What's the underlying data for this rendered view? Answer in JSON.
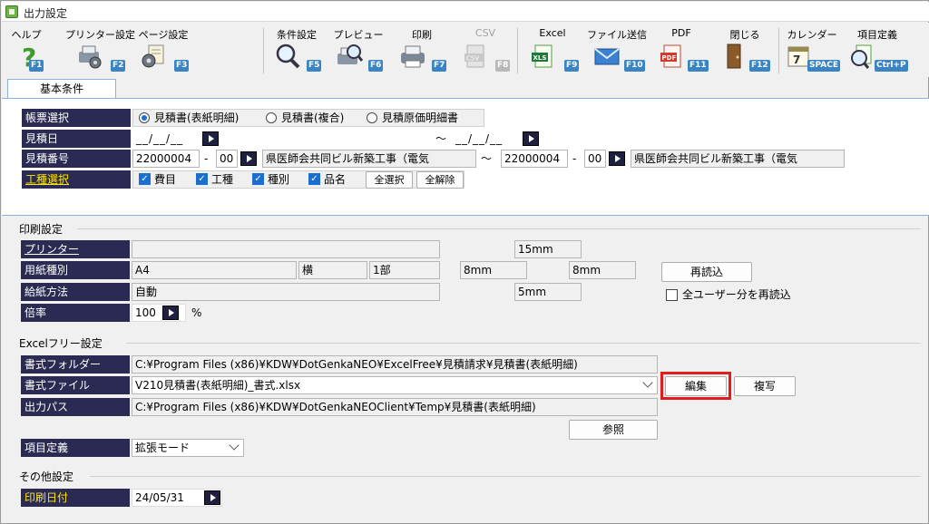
{
  "window": {
    "title": "出力設定"
  },
  "toolbar": [
    {
      "label": "ヘルプ",
      "key": "F1",
      "icon": "help-icon"
    },
    {
      "label": "プリンター設定",
      "key": "F2",
      "icon": "printer-settings-icon"
    },
    {
      "label": "ページ設定",
      "key": "F3",
      "icon": "page-settings-icon"
    },
    {
      "label": "条件設定",
      "key": "F5",
      "icon": "search-condition-icon"
    },
    {
      "label": "プレビュー",
      "key": "F6",
      "icon": "preview-icon"
    },
    {
      "label": "印刷",
      "key": "F7",
      "icon": "print-icon"
    },
    {
      "label": "CSV",
      "key": "F8",
      "icon": "csv-icon",
      "disabled": true
    },
    {
      "label": "Excel",
      "key": "F9",
      "icon": "excel-icon"
    },
    {
      "label": "ファイル送信",
      "key": "F10",
      "icon": "mail-icon"
    },
    {
      "label": "PDF",
      "key": "F11",
      "icon": "pdf-icon"
    },
    {
      "label": "閉じる",
      "key": "F12",
      "icon": "door-exit-icon"
    },
    {
      "label": "カレンダー",
      "key": "SPACE",
      "icon": "calendar-icon"
    },
    {
      "label": "項目定義",
      "key": "Ctrl+P",
      "icon": "field-definition-icon"
    }
  ],
  "tabs": [
    {
      "label": "基本条件"
    }
  ],
  "basic": {
    "report_label": "帳票選択",
    "report_options": [
      "見積書(表紙明細)",
      "見積書(複合)",
      "見積原価明細書"
    ],
    "date_label": "見積日",
    "date_from": "__/__/__",
    "date_tilde": "～",
    "date_to": "__/__/__",
    "number_label": "見積番号",
    "num_from": "22000004",
    "num_dash": "-",
    "num_from_branch": "00",
    "num_from_name": "県医師会共同ビル新築工事（電気",
    "num_tilde": "～",
    "num_to": "22000004",
    "num_to_branch": "00",
    "num_to_name": "県医師会共同ビル新築工事（電気",
    "kind_label": "工種選択",
    "kinds": [
      "費目",
      "工種",
      "種別",
      "品名"
    ],
    "select_all": "全選択",
    "clear_all": "全解除"
  },
  "print": {
    "section": "印刷設定",
    "printer_label": "プリンター",
    "paper_label": "用紙種別",
    "paper_value": "A4",
    "orientation": "横",
    "copies": "1部",
    "feed_label": "給紙方法",
    "feed_value": "自動",
    "scale_label": "倍率",
    "scale_value": "100",
    "scale_unit": "%",
    "margin_top": "15mm",
    "margin_left": "8mm",
    "margin_right": "8mm",
    "margin_bottom": "5mm",
    "reload": "再読込",
    "reload_all_users": "全ユーザー分を再読込"
  },
  "excel": {
    "section": "Excelフリー設定",
    "folder_label": "書式フォルダー",
    "folder_value": "C:¥Program Files (x86)¥KDW¥DotGenkaNEO¥ExcelFree¥見積請求¥見積書(表紙明細)",
    "file_label": "書式ファイル",
    "file_value": "V210見積書(表紙明細)_書式.xlsx",
    "edit": "編集",
    "copy": "複写",
    "output_label": "出力パス",
    "output_value": "C:¥Program Files (x86)¥KDW¥DotGenkaNEOClient¥Temp¥見積書(表紙明細)",
    "browse": "参照",
    "field_def_label": "項目定義",
    "field_def_value": "拡張モード"
  },
  "other": {
    "section": "その他設定",
    "print_date_label": "印刷日付",
    "print_date_value": "24/05/31"
  },
  "colors": {
    "label_bg": "#2a2a52",
    "highlight": "#e01c1c",
    "accent": "#1a6fd0"
  }
}
